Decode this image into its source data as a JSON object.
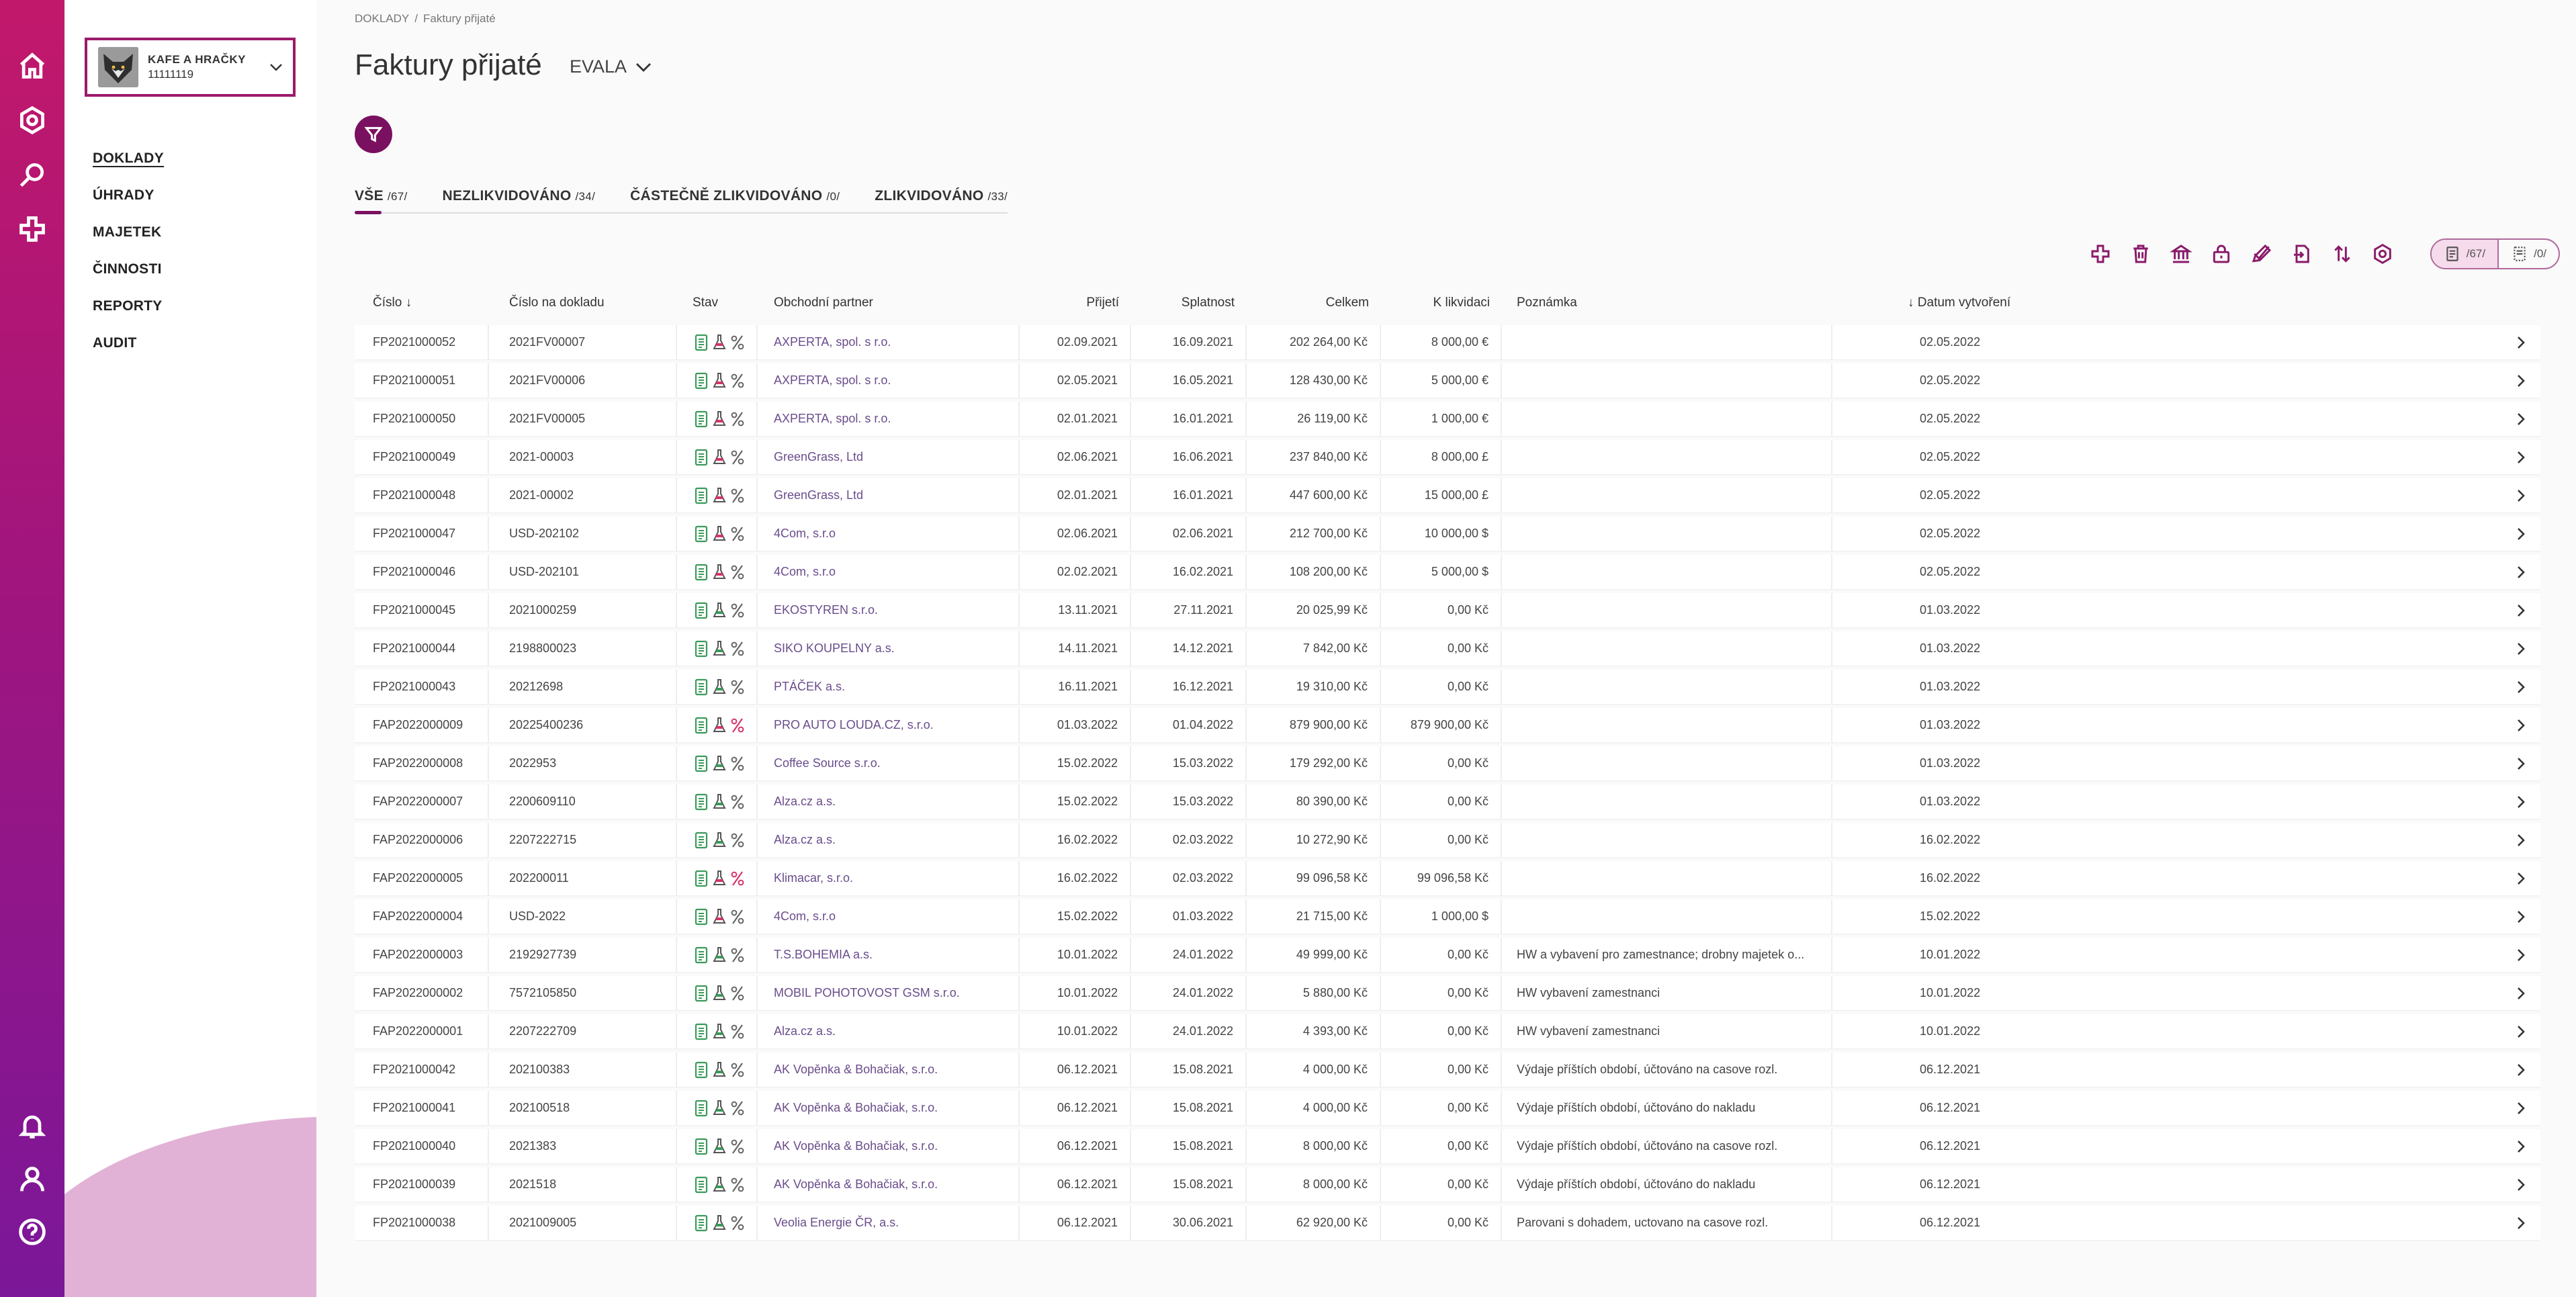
{
  "rail": {
    "top_icons": [
      "home-icon",
      "settings-icon",
      "search-icon",
      "add-icon"
    ],
    "bottom_icons": [
      "bell-icon",
      "user-icon",
      "help-icon"
    ]
  },
  "company": {
    "name": "KAFE A HRAČKY",
    "id": "11111119"
  },
  "nav": {
    "items": [
      "DOKLADY",
      "ÚHRADY",
      "MAJETEK",
      "ČINNOSTI",
      "REPORTY",
      "AUDIT"
    ],
    "active": "DOKLADY"
  },
  "breadcrumb": {
    "root": "DOKLADY",
    "separator": "/",
    "current": "Faktury přijaté"
  },
  "page": {
    "title": "Faktury přijaté",
    "ledger": "EVALA"
  },
  "tabs": [
    {
      "label": "VŠE",
      "count": "/67/"
    },
    {
      "label": "NEZLIKVIDOVÁNO",
      "count": "/34/"
    },
    {
      "label": "ČÁSTEČNĚ ZLIKVIDOVÁNO",
      "count": "/0/"
    },
    {
      "label": "ZLIKVIDOVÁNO",
      "count": "/33/"
    }
  ],
  "toolbar": {
    "icons": [
      "add-icon",
      "trash-icon",
      "bank-icon",
      "lock-icon",
      "approve-icon",
      "export-icon",
      "sort-icon",
      "settings-icon"
    ],
    "view_documents_count": "/67/",
    "view_drafts_count": "/0/"
  },
  "columns": {
    "num": "Číslo",
    "doc": "Číslo na dokladu",
    "stav": "Stav",
    "partner": "Obchodní partner",
    "prij": "Přijetí",
    "spl": "Splatnost",
    "celk": "Celkem",
    "liq": "K likvidaci",
    "note": "Poznámka",
    "dat": "Datum vytvoření"
  },
  "colors": {
    "accent": "#7a1060",
    "ok": "#3a9a5a",
    "bad": "#d8336b",
    "link": "#6a4c8c"
  },
  "rows": [
    {
      "num": "FP2021000052",
      "doc": "2021FV00007",
      "status": [
        "green",
        "red",
        "gray"
      ],
      "partner": "AXPERTA, spol. s r.o.",
      "prij": "02.09.2021",
      "spl": "16.09.2021",
      "celk": "202 264,00 Kč",
      "liq": "8 000,00 €",
      "note": "",
      "dat": "02.05.2022"
    },
    {
      "num": "FP2021000051",
      "doc": "2021FV00006",
      "status": [
        "green",
        "red",
        "gray"
      ],
      "partner": "AXPERTA, spol. s r.o.",
      "prij": "02.05.2021",
      "spl": "16.05.2021",
      "celk": "128 430,00 Kč",
      "liq": "5 000,00 €",
      "note": "",
      "dat": "02.05.2022"
    },
    {
      "num": "FP2021000050",
      "doc": "2021FV00005",
      "status": [
        "green",
        "red",
        "gray"
      ],
      "partner": "AXPERTA, spol. s r.o.",
      "prij": "02.01.2021",
      "spl": "16.01.2021",
      "celk": "26 119,00 Kč",
      "liq": "1 000,00 €",
      "note": "",
      "dat": "02.05.2022"
    },
    {
      "num": "FP2021000049",
      "doc": "2021-00003",
      "status": [
        "green",
        "red",
        "gray"
      ],
      "partner": "GreenGrass, Ltd",
      "prij": "02.06.2021",
      "spl": "16.06.2021",
      "celk": "237 840,00 Kč",
      "liq": "8 000,00 £",
      "note": "",
      "dat": "02.05.2022"
    },
    {
      "num": "FP2021000048",
      "doc": "2021-00002",
      "status": [
        "green",
        "red",
        "gray"
      ],
      "partner": "GreenGrass, Ltd",
      "prij": "02.01.2021",
      "spl": "16.01.2021",
      "celk": "447 600,00 Kč",
      "liq": "15 000,00 £",
      "note": "",
      "dat": "02.05.2022"
    },
    {
      "num": "FP2021000047",
      "doc": "USD-202102",
      "status": [
        "green",
        "red",
        "gray"
      ],
      "partner": "4Com, s.r.o",
      "prij": "02.06.2021",
      "spl": "02.06.2021",
      "celk": "212 700,00 Kč",
      "liq": "10 000,00 $",
      "note": "",
      "dat": "02.05.2022"
    },
    {
      "num": "FP2021000046",
      "doc": "USD-202101",
      "status": [
        "green",
        "red",
        "gray"
      ],
      "partner": "4Com, s.r.o",
      "prij": "02.02.2021",
      "spl": "16.02.2021",
      "celk": "108 200,00 Kč",
      "liq": "5 000,00 $",
      "note": "",
      "dat": "02.05.2022"
    },
    {
      "num": "FP2021000045",
      "doc": "2021000259",
      "status": [
        "green",
        "green",
        "gray"
      ],
      "partner": "EKOSTYREN s.r.o.",
      "prij": "13.11.2021",
      "spl": "27.11.2021",
      "celk": "20 025,99 Kč",
      "liq": "0,00 Kč",
      "note": "",
      "dat": "01.03.2022"
    },
    {
      "num": "FP2021000044",
      "doc": "2198800023",
      "status": [
        "green",
        "green",
        "gray"
      ],
      "partner": "SIKO KOUPELNY a.s.",
      "prij": "14.11.2021",
      "spl": "14.12.2021",
      "celk": "7 842,00 Kč",
      "liq": "0,00 Kč",
      "note": "",
      "dat": "01.03.2022"
    },
    {
      "num": "FP2021000043",
      "doc": "20212698",
      "status": [
        "green",
        "green",
        "gray"
      ],
      "partner": "PTÁČEK a.s.",
      "prij": "16.11.2021",
      "spl": "16.12.2021",
      "celk": "19 310,00 Kč",
      "liq": "0,00 Kč",
      "note": "",
      "dat": "01.03.2022"
    },
    {
      "num": "FAP2022000009",
      "doc": "20225400236",
      "status": [
        "green",
        "red",
        "red"
      ],
      "partner": "PRO AUTO LOUDA.CZ, s.r.o.",
      "prij": "01.03.2022",
      "spl": "01.04.2022",
      "celk": "879 900,00 Kč",
      "liq": "879 900,00 Kč",
      "note": "",
      "dat": "01.03.2022"
    },
    {
      "num": "FAP2022000008",
      "doc": "2022953",
      "status": [
        "green",
        "green",
        "gray"
      ],
      "partner": "Coffee Source s.r.o.",
      "prij": "15.02.2022",
      "spl": "15.03.2022",
      "celk": "179 292,00 Kč",
      "liq": "0,00 Kč",
      "note": "",
      "dat": "01.03.2022"
    },
    {
      "num": "FAP2022000007",
      "doc": "2200609110",
      "status": [
        "green",
        "green",
        "gray"
      ],
      "partner": "Alza.cz a.s.",
      "prij": "15.02.2022",
      "spl": "15.03.2022",
      "celk": "80 390,00 Kč",
      "liq": "0,00 Kč",
      "note": "",
      "dat": "01.03.2022"
    },
    {
      "num": "FAP2022000006",
      "doc": "2207222715",
      "status": [
        "green",
        "green",
        "gray"
      ],
      "partner": "Alza.cz a.s.",
      "prij": "16.02.2022",
      "spl": "02.03.2022",
      "celk": "10 272,90 Kč",
      "liq": "0,00 Kč",
      "note": "",
      "dat": "16.02.2022"
    },
    {
      "num": "FAP2022000005",
      "doc": "202200011",
      "status": [
        "green",
        "red",
        "red"
      ],
      "partner": "Klimacar, s.r.o.",
      "prij": "16.02.2022",
      "spl": "02.03.2022",
      "celk": "99 096,58 Kč",
      "liq": "99 096,58 Kč",
      "note": "",
      "dat": "16.02.2022"
    },
    {
      "num": "FAP2022000004",
      "doc": "USD-2022",
      "status": [
        "green",
        "red",
        "gray"
      ],
      "partner": "4Com, s.r.o",
      "prij": "15.02.2022",
      "spl": "01.03.2022",
      "celk": "21 715,00 Kč",
      "liq": "1 000,00 $",
      "note": "",
      "dat": "15.02.2022"
    },
    {
      "num": "FAP2022000003",
      "doc": "2192927739",
      "status": [
        "green",
        "green",
        "gray"
      ],
      "partner": "T.S.BOHEMIA a.s.",
      "prij": "10.01.2022",
      "spl": "24.01.2022",
      "celk": "49 999,00 Kč",
      "liq": "0,00 Kč",
      "note": "HW a vybavení pro zamestnance; drobny majetek o...",
      "dat": "10.01.2022"
    },
    {
      "num": "FAP2022000002",
      "doc": "7572105850",
      "status": [
        "green",
        "green",
        "gray"
      ],
      "partner": "MOBIL POHOTOVOST GSM s.r.o.",
      "prij": "10.01.2022",
      "spl": "24.01.2022",
      "celk": "5 880,00 Kč",
      "liq": "0,00 Kč",
      "note": "HW vybavení zamestnanci",
      "dat": "10.01.2022"
    },
    {
      "num": "FAP2022000001",
      "doc": "2207222709",
      "status": [
        "green",
        "green",
        "gray"
      ],
      "partner": "Alza.cz a.s.",
      "prij": "10.01.2022",
      "spl": "24.01.2022",
      "celk": "4 393,00 Kč",
      "liq": "0,00 Kč",
      "note": "HW vybavení zamestnanci",
      "dat": "10.01.2022"
    },
    {
      "num": "FP2021000042",
      "doc": "202100383",
      "status": [
        "green",
        "green",
        "gray"
      ],
      "partner": "AK Vopěnka & Bohačiak, s.r.o.",
      "prij": "06.12.2021",
      "spl": "15.08.2021",
      "celk": "4 000,00 Kč",
      "liq": "0,00 Kč",
      "note": "Výdaje příštích období, účtováno na casove rozl.",
      "dat": "06.12.2021"
    },
    {
      "num": "FP2021000041",
      "doc": "202100518",
      "status": [
        "green",
        "green",
        "gray"
      ],
      "partner": "AK Vopěnka & Bohačiak, s.r.o.",
      "prij": "06.12.2021",
      "spl": "15.08.2021",
      "celk": "4 000,00 Kč",
      "liq": "0,00 Kč",
      "note": "Výdaje příštích období, účtováno do nakladu",
      "dat": "06.12.2021"
    },
    {
      "num": "FP2021000040",
      "doc": "2021383",
      "status": [
        "green",
        "green",
        "gray"
      ],
      "partner": "AK Vopěnka & Bohačiak, s.r.o.",
      "prij": "06.12.2021",
      "spl": "15.08.2021",
      "celk": "8 000,00 Kč",
      "liq": "0,00 Kč",
      "note": "Výdaje příštích období, účtováno na casove rozl.",
      "dat": "06.12.2021"
    },
    {
      "num": "FP2021000039",
      "doc": "2021518",
      "status": [
        "green",
        "green",
        "gray"
      ],
      "partner": "AK Vopěnka & Bohačiak, s.r.o.",
      "prij": "06.12.2021",
      "spl": "15.08.2021",
      "celk": "8 000,00 Kč",
      "liq": "0,00 Kč",
      "note": "Výdaje příštích období, účtováno do nakladu",
      "dat": "06.12.2021"
    },
    {
      "num": "FP2021000038",
      "doc": "2021009005",
      "status": [
        "green",
        "green",
        "gray"
      ],
      "partner": "Veolia Energie ČR, a.s.",
      "prij": "06.12.2021",
      "spl": "30.06.2021",
      "celk": "62 920,00 Kč",
      "liq": "0,00 Kč",
      "note": "Parovani s dohadem, uctovano na casove rozl.",
      "dat": "06.12.2021"
    }
  ]
}
